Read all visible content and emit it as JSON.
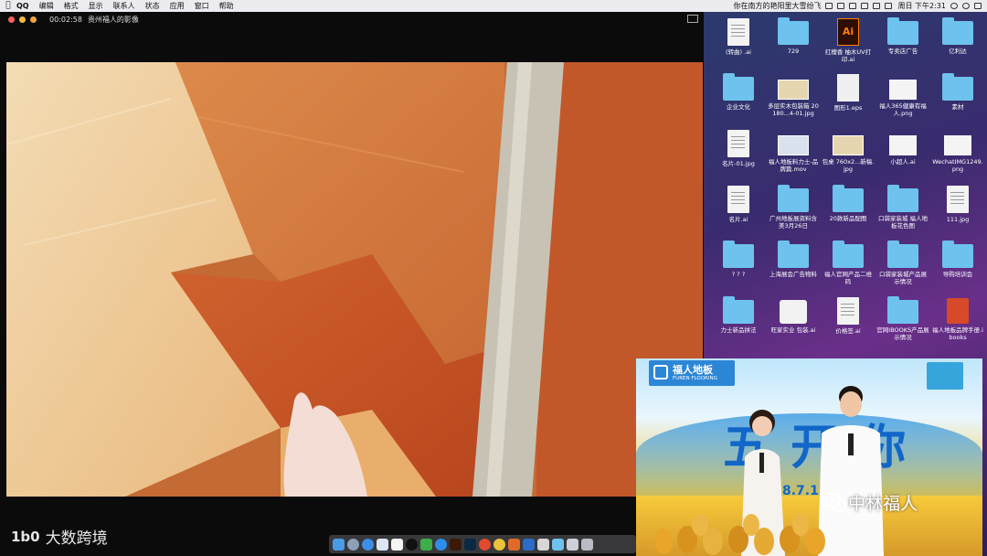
{
  "menubar": {
    "apple": "",
    "items": [
      "QQ",
      "编辑",
      "格式",
      "显示",
      "联系人",
      "状态",
      "应用",
      "窗口",
      "帮助"
    ],
    "broadcast": "你在南方的艳阳里大雪纷飞",
    "clock": "周日 下午2:31"
  },
  "player": {
    "time": "00:02:58",
    "title": "贵州福人的影像"
  },
  "desktop": {
    "rows": [
      [
        {
          "label": "(转曲) .ai",
          "type": "doc"
        },
        {
          "label": "729",
          "type": "folder"
        },
        {
          "label": "红檀香 柚木UV打印.ai",
          "type": "ai"
        },
        {
          "label": "专卖店广告",
          "type": "folder"
        },
        {
          "label": "亿利达",
          "type": "folder"
        }
      ],
      [
        {
          "label": "企业文化",
          "type": "folder"
        },
        {
          "label": "多层实木包装箱 20180...4-01.jpg",
          "type": "img"
        },
        {
          "label": "图形1.eps",
          "type": "eps"
        },
        {
          "label": "福人365健康有福人.png",
          "type": "png"
        },
        {
          "label": "素材",
          "type": "folder"
        }
      ],
      [
        {
          "label": "名片-01.jpg",
          "type": "doc"
        },
        {
          "label": "福人地板料力士-品牌篇.mov",
          "type": "movie"
        },
        {
          "label": "包桌 760x2...新稿.jpg",
          "type": "img"
        },
        {
          "label": "小超人.ai",
          "type": "png"
        },
        {
          "label": "WechatIMG1249.png",
          "type": "png"
        }
      ],
      [
        {
          "label": "名片.ai",
          "type": "doc"
        },
        {
          "label": "广州地板展资料含美3月26日",
          "type": "folder"
        },
        {
          "label": "20款新品配图",
          "type": "folder"
        },
        {
          "label": "口袋家装城 福人地板花色图",
          "type": "folder"
        },
        {
          "label": "111.jpg",
          "type": "doc"
        }
      ],
      [
        {
          "label": "? ? ?",
          "type": "folder"
        },
        {
          "label": "上海展会广告物料",
          "type": "folder"
        },
        {
          "label": "福人官网产品二维码",
          "type": "folder"
        },
        {
          "label": "口袋家装城产品展示情况",
          "type": "folder"
        },
        {
          "label": "导购培训会",
          "type": "folder"
        }
      ],
      [
        {
          "label": "力士新品拼法",
          "type": "folder"
        },
        {
          "label": "旺家实业 包装.ai",
          "type": "keynote"
        },
        {
          "label": "价格签.ai",
          "type": "doc"
        },
        {
          "label": "官网IBOOKS产品展示情况",
          "type": "folder"
        },
        {
          "label": "福人地板品牌手册.ibooks",
          "type": "book"
        }
      ]
    ]
  },
  "stream": {
    "brand_title": "福人地板",
    "brand_sub": "FUREN FLOORING",
    "big_text": "五 开 你",
    "date": "8.7.15",
    "watermark": "中林福人"
  },
  "watermark_brand": {
    "logo": "1b0",
    "name": "大数跨境"
  },
  "colors": {
    "menubar_bg": "#ecebef",
    "desktop_bg": "#3a2b6e",
    "folder": "#6ec2ee",
    "brand_blue": "#2c86d6"
  }
}
